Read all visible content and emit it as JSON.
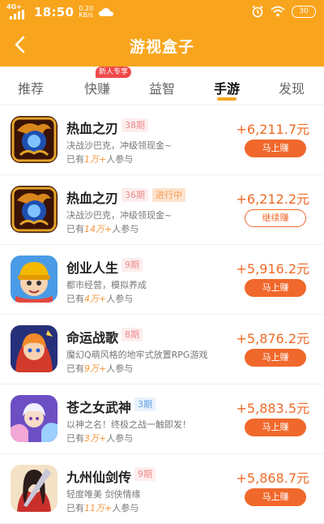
{
  "status_bar": {
    "network": "4G+",
    "time": "18:50",
    "net_speed_value": "0.20",
    "net_speed_unit": "KB/s",
    "battery": "30",
    "icons": [
      "signal-icon",
      "cloud-icon",
      "alarm-icon",
      "wifi-icon",
      "battery-icon"
    ]
  },
  "header": {
    "title": "游视盒子",
    "back_icon": "chevron-left-icon",
    "bg_color": "#f8a51d"
  },
  "tabs": {
    "items": [
      {
        "label": "推荐"
      },
      {
        "label": "快赚",
        "badge": "新人专享"
      },
      {
        "label": "益智"
      },
      {
        "label": "手游"
      },
      {
        "label": "发现"
      }
    ],
    "active": "手游",
    "accent_color": "#f5a623"
  },
  "games": [
    {
      "name": "热血之刃",
      "period": "38期",
      "status": "",
      "desc": "决战沙巴克，冲级领现金~",
      "joined_prefix": "已有",
      "joined_count": "1万+",
      "joined_suffix": "人参与",
      "reward": "+6,211.7元",
      "action": "马上赚",
      "icon": "dragon-game-icon"
    },
    {
      "name": "热血之刃",
      "period": "36期",
      "status": "进行中",
      "desc": "决战沙巴克，冲级领现金~",
      "joined_prefix": "已有",
      "joined_count": "14万+",
      "joined_suffix": "人参与",
      "reward": "+6,212.2元",
      "action": "继续赚",
      "icon": "dragon-game-icon"
    },
    {
      "name": "创业人生",
      "period": "9期",
      "status": "",
      "desc": "都市经营，模拟养成",
      "joined_prefix": "已有",
      "joined_count": "4万+",
      "joined_suffix": "人参与",
      "reward": "+5,916.2元",
      "action": "马上赚",
      "icon": "cartoon-worker-game-icon"
    },
    {
      "name": "命运战歌",
      "period": "8期",
      "status": "",
      "desc": "魔幻Q萌风格的地牢式放置RPG游戏",
      "joined_prefix": "已有",
      "joined_count": "9万+",
      "joined_suffix": "人参与",
      "reward": "+5,876.2元",
      "action": "马上赚",
      "icon": "fantasy-hero-game-icon"
    },
    {
      "name": "苍之女武神",
      "period": "3期",
      "status": "",
      "desc": "以神之名！终极之战一触即发！",
      "joined_prefix": "已有",
      "joined_count": "3万+",
      "joined_suffix": "人参与",
      "reward": "+5,883.5元",
      "action": "马上赚",
      "icon": "valkyrie-game-icon"
    },
    {
      "name": "九州仙剑传",
      "period": "9期",
      "status": "",
      "desc": "轻度唯美 剑侠情缘",
      "joined_prefix": "已有",
      "joined_count": "11万+",
      "joined_suffix": "人参与",
      "reward": "+5,868.7元",
      "action": "马上赚",
      "icon": "swordsman-game-icon"
    }
  ]
}
